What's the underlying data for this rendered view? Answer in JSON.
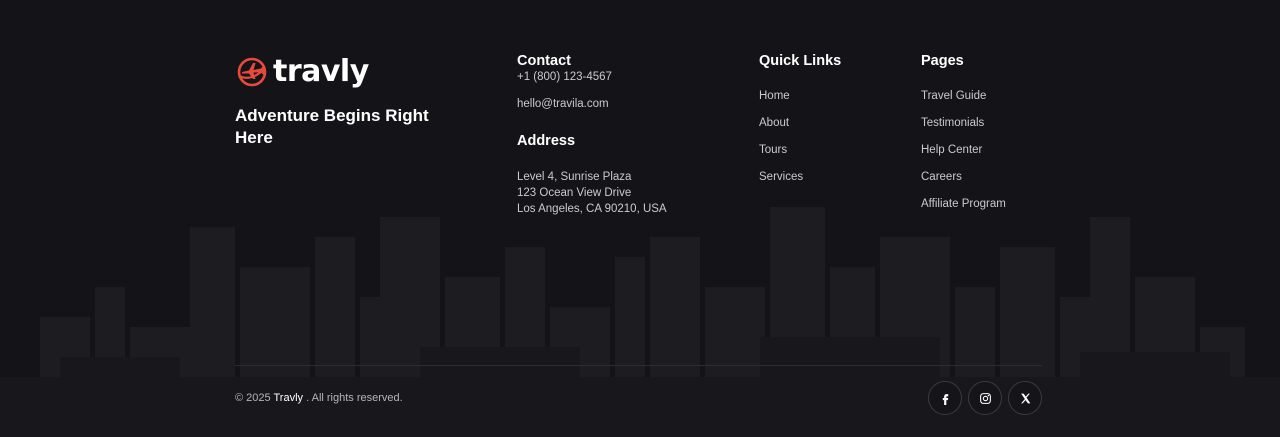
{
  "brand": {
    "name": "travly",
    "tagline": "Adventure Begins Right Here",
    "accent_color": "#e8493a",
    "logo_icon": "airplane-globe-icon"
  },
  "contact": {
    "title": "Contact",
    "phone": "+1 (800) 123-4567",
    "email": "hello@travila.com"
  },
  "address": {
    "title": "Address",
    "lines": [
      "Level 4, Sunrise Plaza",
      "123 Ocean View Drive",
      "Los Angeles, CA 90210, USA"
    ]
  },
  "quick_links": {
    "title": "Quick Links",
    "items": [
      "Home",
      "About",
      "Tours",
      "Services"
    ]
  },
  "pages": {
    "title": "Pages",
    "items": [
      "Travel Guide",
      "Testimonials",
      "Help Center",
      "Careers",
      "Affiliate Program"
    ]
  },
  "footer_bottom": {
    "copyright_prefix": "© 2025",
    "copyright_brand": "Travly",
    "copyright_suffix": ". All rights reserved."
  },
  "social": [
    {
      "icon": "facebook-icon"
    },
    {
      "icon": "instagram-icon"
    },
    {
      "icon": "x-twitter-icon"
    }
  ]
}
